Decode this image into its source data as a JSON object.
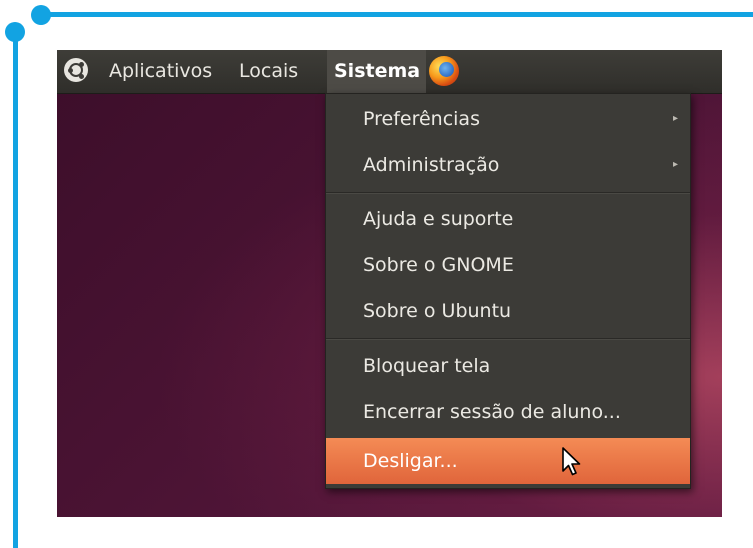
{
  "panel": {
    "logo_icon": "ubuntu-logo-icon",
    "items": [
      {
        "label": "Aplicativos"
      },
      {
        "label": "Locais"
      },
      {
        "label": "Sistema"
      }
    ],
    "browser_icon": "firefox-icon"
  },
  "menu": {
    "items": [
      {
        "label": "Preferências",
        "submenu_arrow": "▸"
      },
      {
        "label": "Administração",
        "submenu_arrow": "▸"
      },
      {
        "label": "Ajuda e suporte"
      },
      {
        "label": "Sobre o GNOME"
      },
      {
        "label": "Sobre o Ubuntu"
      },
      {
        "label": "Bloquear tela"
      },
      {
        "label": "Encerrar sessão de aluno..."
      },
      {
        "label": "Desligar..."
      }
    ],
    "highlight_color": "#ef7b48"
  },
  "colors": {
    "frame_line": "#12a3e2",
    "panel": "#3c3b37",
    "desktop": "#4a1333"
  }
}
